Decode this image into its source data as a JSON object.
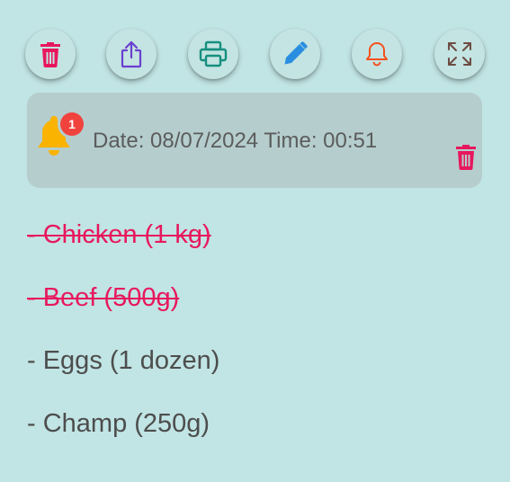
{
  "toolbar": {
    "buttons": [
      {
        "name": "delete",
        "icon": "trash-icon",
        "color": "#e8175d"
      },
      {
        "name": "share",
        "icon": "share-icon",
        "color": "#6a3fcf"
      },
      {
        "name": "print",
        "icon": "printer-icon",
        "color": "#168f7e"
      },
      {
        "name": "edit",
        "icon": "pencil-icon",
        "color": "#2a8ee0"
      },
      {
        "name": "reminder",
        "icon": "bell-icon",
        "color": "#f4511e"
      },
      {
        "name": "fullscreen",
        "icon": "expand-icon",
        "color": "#6d4c41"
      }
    ]
  },
  "reminder": {
    "icon": "bell-icon",
    "icon_color": "#f9b300",
    "badge_count": "1",
    "badge_color": "#f1433e",
    "text": "Date: 08/07/2024 Time: 00:51",
    "delete_icon": "trash-icon",
    "delete_color": "#e8175d"
  },
  "items": [
    {
      "label": "- Chicken (1 kg)",
      "done": true
    },
    {
      "label": "- Beef (500g)",
      "done": true
    },
    {
      "label": "- Eggs (1 dozen)",
      "done": false
    },
    {
      "label": "- Champ (250g)",
      "done": false
    }
  ],
  "colors": {
    "background": "#c1e4e4",
    "card": "#b5cdcd",
    "done_text": "#e8175d",
    "text": "#4d4d4d"
  }
}
